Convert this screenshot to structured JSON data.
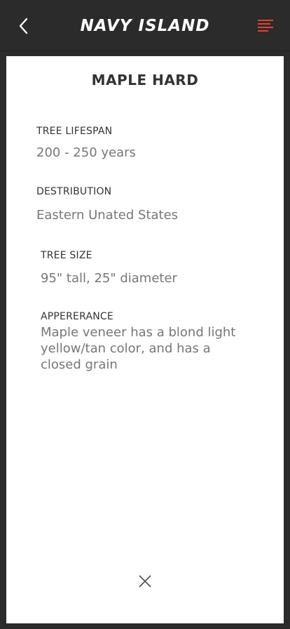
{
  "header": {
    "brand": "NAVY ISLAND",
    "back_icon": "chevron-left-icon",
    "menu_icon": "menu-lines-icon",
    "accent_color": "#e8402e"
  },
  "detail": {
    "title": "MAPLE HARD",
    "fields": [
      {
        "label": "TREE LIFESPAN",
        "value": "200 - 250 years"
      },
      {
        "label": "DESTRIBUTION",
        "value": "Eastern Unated States"
      },
      {
        "label": "TREE SIZE",
        "value": "95\" tall, 25\" diameter"
      },
      {
        "label": "APPERERANCE",
        "value": "Maple veneer has a blond light yellow/tan color, and has a closed grain"
      }
    ],
    "close_icon": "close-icon"
  }
}
